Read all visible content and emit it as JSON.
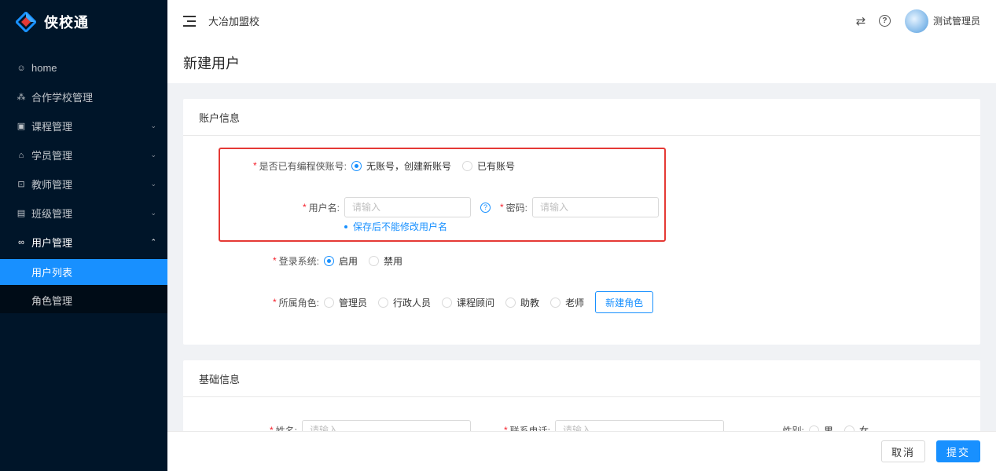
{
  "app": {
    "logo_text": "侠校通",
    "brand_color": "#1890ff",
    "sidebar_bg": "#001529"
  },
  "sidebar": {
    "items": [
      {
        "icon": "smile-icon",
        "label": "home",
        "expandable": false
      },
      {
        "icon": "cluster-icon",
        "label": "合作学校管理",
        "expandable": false
      },
      {
        "icon": "book-icon",
        "label": "课程管理",
        "expandable": true
      },
      {
        "icon": "graduation-icon",
        "label": "学员管理",
        "expandable": true
      },
      {
        "icon": "teacher-icon",
        "label": "教师管理",
        "expandable": true
      },
      {
        "icon": "class-icon",
        "label": "班级管理",
        "expandable": true
      },
      {
        "icon": "users-icon",
        "label": "用户管理",
        "expandable": true,
        "open": true
      }
    ],
    "submenu": [
      {
        "label": "用户列表",
        "active": true
      },
      {
        "label": "角色管理",
        "active": false
      }
    ]
  },
  "header": {
    "school_name": "大冶加盟校",
    "user_name": "测试管理员"
  },
  "page": {
    "title": "新建用户"
  },
  "account_card": {
    "title": "账户信息",
    "has_account_label": "是否已有编程侠账号:",
    "has_account_options": [
      "无账号，创建新账号",
      "已有账号"
    ],
    "has_account_selected": 0,
    "username_label": "用户名:",
    "username_placeholder": "请输入",
    "password_label": "密码:",
    "password_placeholder": "请输入",
    "username_hint": "保存后不能修改用户名",
    "login_label": "登录系统:",
    "login_options": [
      "启用",
      "禁用"
    ],
    "login_selected": 0,
    "role_label": "所属角色:",
    "role_options": [
      "管理员",
      "行政人员",
      "课程顾问",
      "助教",
      "老师"
    ],
    "new_role_button": "新建角色"
  },
  "basic_card": {
    "title": "基础信息",
    "name_label": "姓名:",
    "name_placeholder": "请输入",
    "phone_label": "联系电话:",
    "phone_placeholder": "请输入",
    "gender_label": "性别:",
    "gender_options": [
      "男",
      "女"
    ]
  },
  "footer": {
    "cancel_label": "取消",
    "submit_label": "提交"
  }
}
